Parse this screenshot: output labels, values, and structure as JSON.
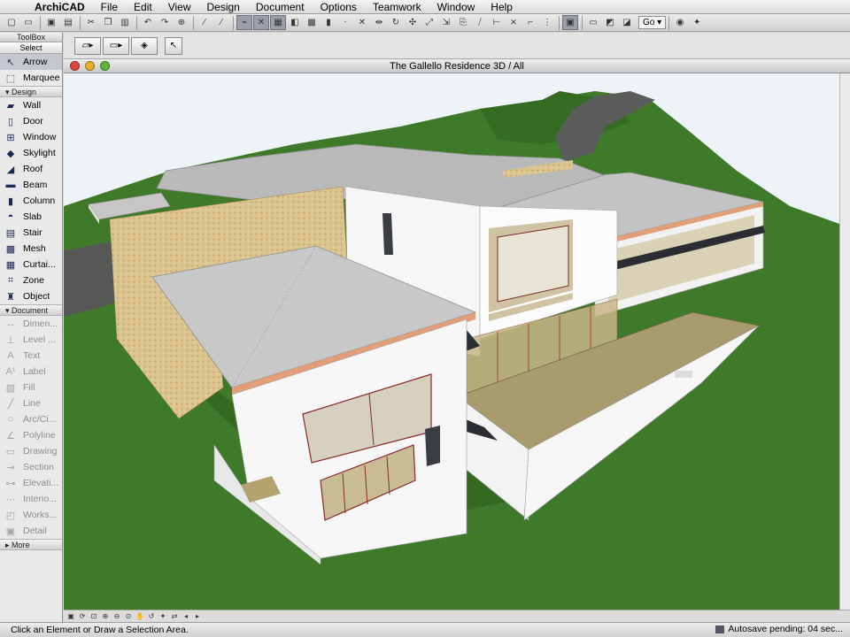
{
  "menubar": {
    "app_name": "ArchiCAD",
    "items": [
      "File",
      "Edit",
      "View",
      "Design",
      "Document",
      "Options",
      "Teamwork",
      "Window",
      "Help"
    ]
  },
  "toolbar": {
    "go_label": "Go ▾"
  },
  "toolbox": {
    "title": "ToolBox",
    "select_label": "Select",
    "pointer_tools": [
      {
        "label": "Arrow",
        "icon": "arrow-icon"
      },
      {
        "label": "Marquee",
        "icon": "marquee-icon"
      }
    ],
    "design_label": "Design",
    "design_tools": [
      {
        "label": "Wall",
        "icon": "wall-icon"
      },
      {
        "label": "Door",
        "icon": "door-icon"
      },
      {
        "label": "Window",
        "icon": "window-icon"
      },
      {
        "label": "Skylight",
        "icon": "skylight-icon"
      },
      {
        "label": "Roof",
        "icon": "roof-icon"
      },
      {
        "label": "Beam",
        "icon": "beam-icon"
      },
      {
        "label": "Column",
        "icon": "column-icon"
      },
      {
        "label": "Slab",
        "icon": "slab-icon"
      },
      {
        "label": "Stair",
        "icon": "stair-icon"
      },
      {
        "label": "Mesh",
        "icon": "mesh-icon"
      },
      {
        "label": "Curtai...",
        "icon": "curtain-wall-icon"
      },
      {
        "label": "Zone",
        "icon": "zone-icon"
      },
      {
        "label": "Object",
        "icon": "object-icon"
      }
    ],
    "document_label": "Document",
    "document_tools": [
      {
        "label": "Dimen...",
        "icon": "dimension-icon"
      },
      {
        "label": "Level ...",
        "icon": "level-dimension-icon"
      },
      {
        "label": "Text",
        "icon": "text-icon"
      },
      {
        "label": "Label",
        "icon": "label-icon"
      },
      {
        "label": "Fill",
        "icon": "fill-icon"
      },
      {
        "label": "Line",
        "icon": "line-icon"
      },
      {
        "label": "Arc/Ci...",
        "icon": "arc-icon"
      },
      {
        "label": "Polyline",
        "icon": "polyline-icon"
      },
      {
        "label": "Drawing",
        "icon": "drawing-icon"
      },
      {
        "label": "Section",
        "icon": "section-icon"
      },
      {
        "label": "Elevati...",
        "icon": "elevation-icon"
      },
      {
        "label": "Interio...",
        "icon": "interior-elevation-icon"
      },
      {
        "label": "Works...",
        "icon": "worksheet-icon"
      },
      {
        "label": "Detail",
        "icon": "detail-icon"
      }
    ],
    "more_label": "More"
  },
  "window": {
    "title": "The Gallello Residence 3D / All"
  },
  "status": {
    "message": "Click an Element or Draw a Selection Area.",
    "autosave": "Autosave pending: 04 sec..."
  },
  "colors": {
    "grass": "#3f7a2a",
    "sky": "#eef3f7",
    "roof": "#b9b9b9",
    "stone": "#dbc38d",
    "deck": "#a99b6e"
  }
}
